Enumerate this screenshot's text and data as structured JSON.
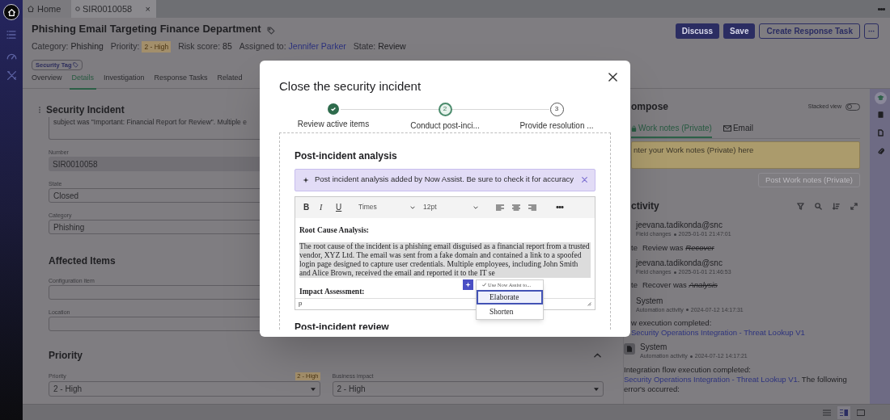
{
  "tabs": [
    {
      "label": "Home",
      "kind": "home",
      "selected": false
    },
    {
      "label": "SIR0010058",
      "kind": "record",
      "selected": true,
      "close": "×"
    }
  ],
  "record": {
    "title": "Phishing Email Targeting Finance Department",
    "meta": [
      {
        "label": "Category:",
        "value": "Phishing",
        "kind": "text"
      },
      {
        "label": "Priority:",
        "value": "2 - High",
        "kind": "badge"
      },
      {
        "label": "Risk score:",
        "value": "85",
        "kind": "text"
      },
      {
        "label": "Assigned to:",
        "value": "Jennifer Parker",
        "kind": "link"
      },
      {
        "label": "State:",
        "value": "Review",
        "kind": "text"
      }
    ],
    "tag": "Security Tag"
  },
  "actions": [
    {
      "label": "Discuss",
      "kind": "primary"
    },
    {
      "label": "Save",
      "kind": "primary"
    },
    {
      "label": "Create Response Task",
      "kind": "outline"
    },
    {
      "kind": "more"
    }
  ],
  "form_tabs": [
    {
      "label": "Overview",
      "selected": false
    },
    {
      "label": "Details",
      "selected": true
    },
    {
      "label": "Investigation",
      "selected": false
    },
    {
      "label": "Response Tasks",
      "selected": false
    },
    {
      "label": "Related",
      "selected": false
    }
  ],
  "form": {
    "section": "Security Incident",
    "description": "subject was \"Important: Financial Report for Review\". Multiple e",
    "fields": [
      {
        "label": "Number",
        "value": "SIR0010058",
        "readonly": true
      },
      {
        "label": "State",
        "value": "Closed",
        "readonly": false
      },
      {
        "label": "Category",
        "value": "Phishing",
        "readonly": false
      }
    ],
    "affected_title": "Affected Items",
    "affected_fields": [
      {
        "label": "Configuration item"
      },
      {
        "label": "Location"
      }
    ],
    "priority": {
      "title": "Priority",
      "expanded": true,
      "fields": [
        {
          "label": "Priority",
          "value": "2 - High",
          "badge": "2 - High"
        },
        {
          "label": "Business impact",
          "value": "2 - High"
        }
      ]
    }
  },
  "compose": {
    "title": "ompose",
    "stacked_view": {
      "label": "Stacked view",
      "on": false
    },
    "tabs": [
      {
        "label": "Work notes (Private)",
        "kind": "lock",
        "selected": true
      },
      {
        "label": "Email",
        "kind": "mail",
        "selected": false
      }
    ],
    "placeholder": "nter your Work notes (Private) here",
    "post_button": {
      "label": "Post Work notes (Private)",
      "disabled": true
    }
  },
  "activity": {
    "title": "ctivity",
    "entries": [
      {
        "kind": "field",
        "author": "jeevana.tadikonda@snc",
        "type": "Field changes",
        "time": "2025-01-01 21:47:01",
        "field": "te",
        "value": "Review was",
        "old": "Recover"
      },
      {
        "kind": "field",
        "author": "jeevana.tadikonda@snc",
        "type": "Field changes",
        "time": "2025-01-01 21:46:53",
        "field": "te",
        "value": "Recover was",
        "old": "Analysis"
      },
      {
        "kind": "automation",
        "author": "System",
        "type": "Automation activity",
        "time": "2024-07-12 14:17:31",
        "text": "w execution completed:",
        "link": "Security Operations Integration - Threat Lookup V1"
      },
      {
        "kind": "automation",
        "author": "System",
        "type": "Automation activity",
        "time": "2024-07-12 14:17:21",
        "text": "Integration flow execution completed:",
        "link": "Security Operations Integration - Threat Lookup V1",
        "after": ". The following error's occurred:"
      }
    ]
  },
  "modal": {
    "title": "Close the security incident",
    "steps": [
      {
        "label": "Review active items",
        "completed": true,
        "selected": false
      },
      {
        "number": "2",
        "label": "Conduct post-inci...",
        "completed": false,
        "selected": true
      },
      {
        "number": "3",
        "label": "Provide resolution ...",
        "completed": false,
        "selected": false
      }
    ],
    "section_title": "Post-incident analysis",
    "banner": "Post incident analysis added by Now Assist. Be sure to check it for accuracy",
    "editor": {
      "format_buttons": [
        {
          "label": "B",
          "kind": "bold"
        },
        {
          "label": "I",
          "kind": "italic"
        },
        {
          "label": "U",
          "kind": "underline"
        }
      ],
      "font": "Times",
      "size": "12pt",
      "heading_1": "Root Cause Analysis:",
      "body": "The root cause of the incident is a phishing email disguised as a financial report from a trusted vendor, XYZ Ltd. The email was sent from a fake domain and contained a link to a spoofed login page designed to capture user credentials. Multiple employees, including John Smith and Alice Brown, received the email and reported it to the IT se",
      "heading_2": "Impact Assessment:",
      "status_path": "p"
    },
    "assist_menu": {
      "title": "Use Now Assist to...",
      "items": [
        {
          "label": "Elaborate",
          "selected": true
        },
        {
          "label": "Shorten",
          "selected": false
        }
      ]
    },
    "next_section_title": "Post-incident review"
  }
}
